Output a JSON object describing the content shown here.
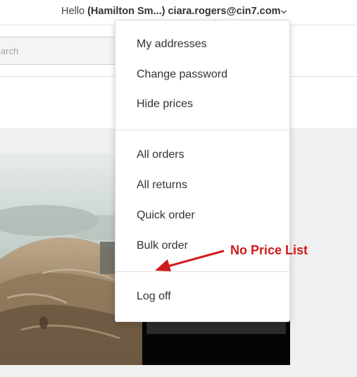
{
  "header": {
    "greeting_prefix": "Hello",
    "account_label": "(Hamilton Sm...) ciara.rogers@cin7.com",
    "caret_icon": "chevron-down-icon"
  },
  "search": {
    "placeholder": "Search"
  },
  "account_menu": {
    "group1": [
      "My addresses",
      "Change password",
      "Hide prices"
    ],
    "group2": [
      "All orders",
      "All returns",
      "Quick order",
      "Bulk order"
    ],
    "group3": [
      "Log off"
    ]
  },
  "annotation": {
    "label": "No Price List",
    "color": "#d11a1a",
    "arrow_icon": "red-arrow-icon"
  }
}
